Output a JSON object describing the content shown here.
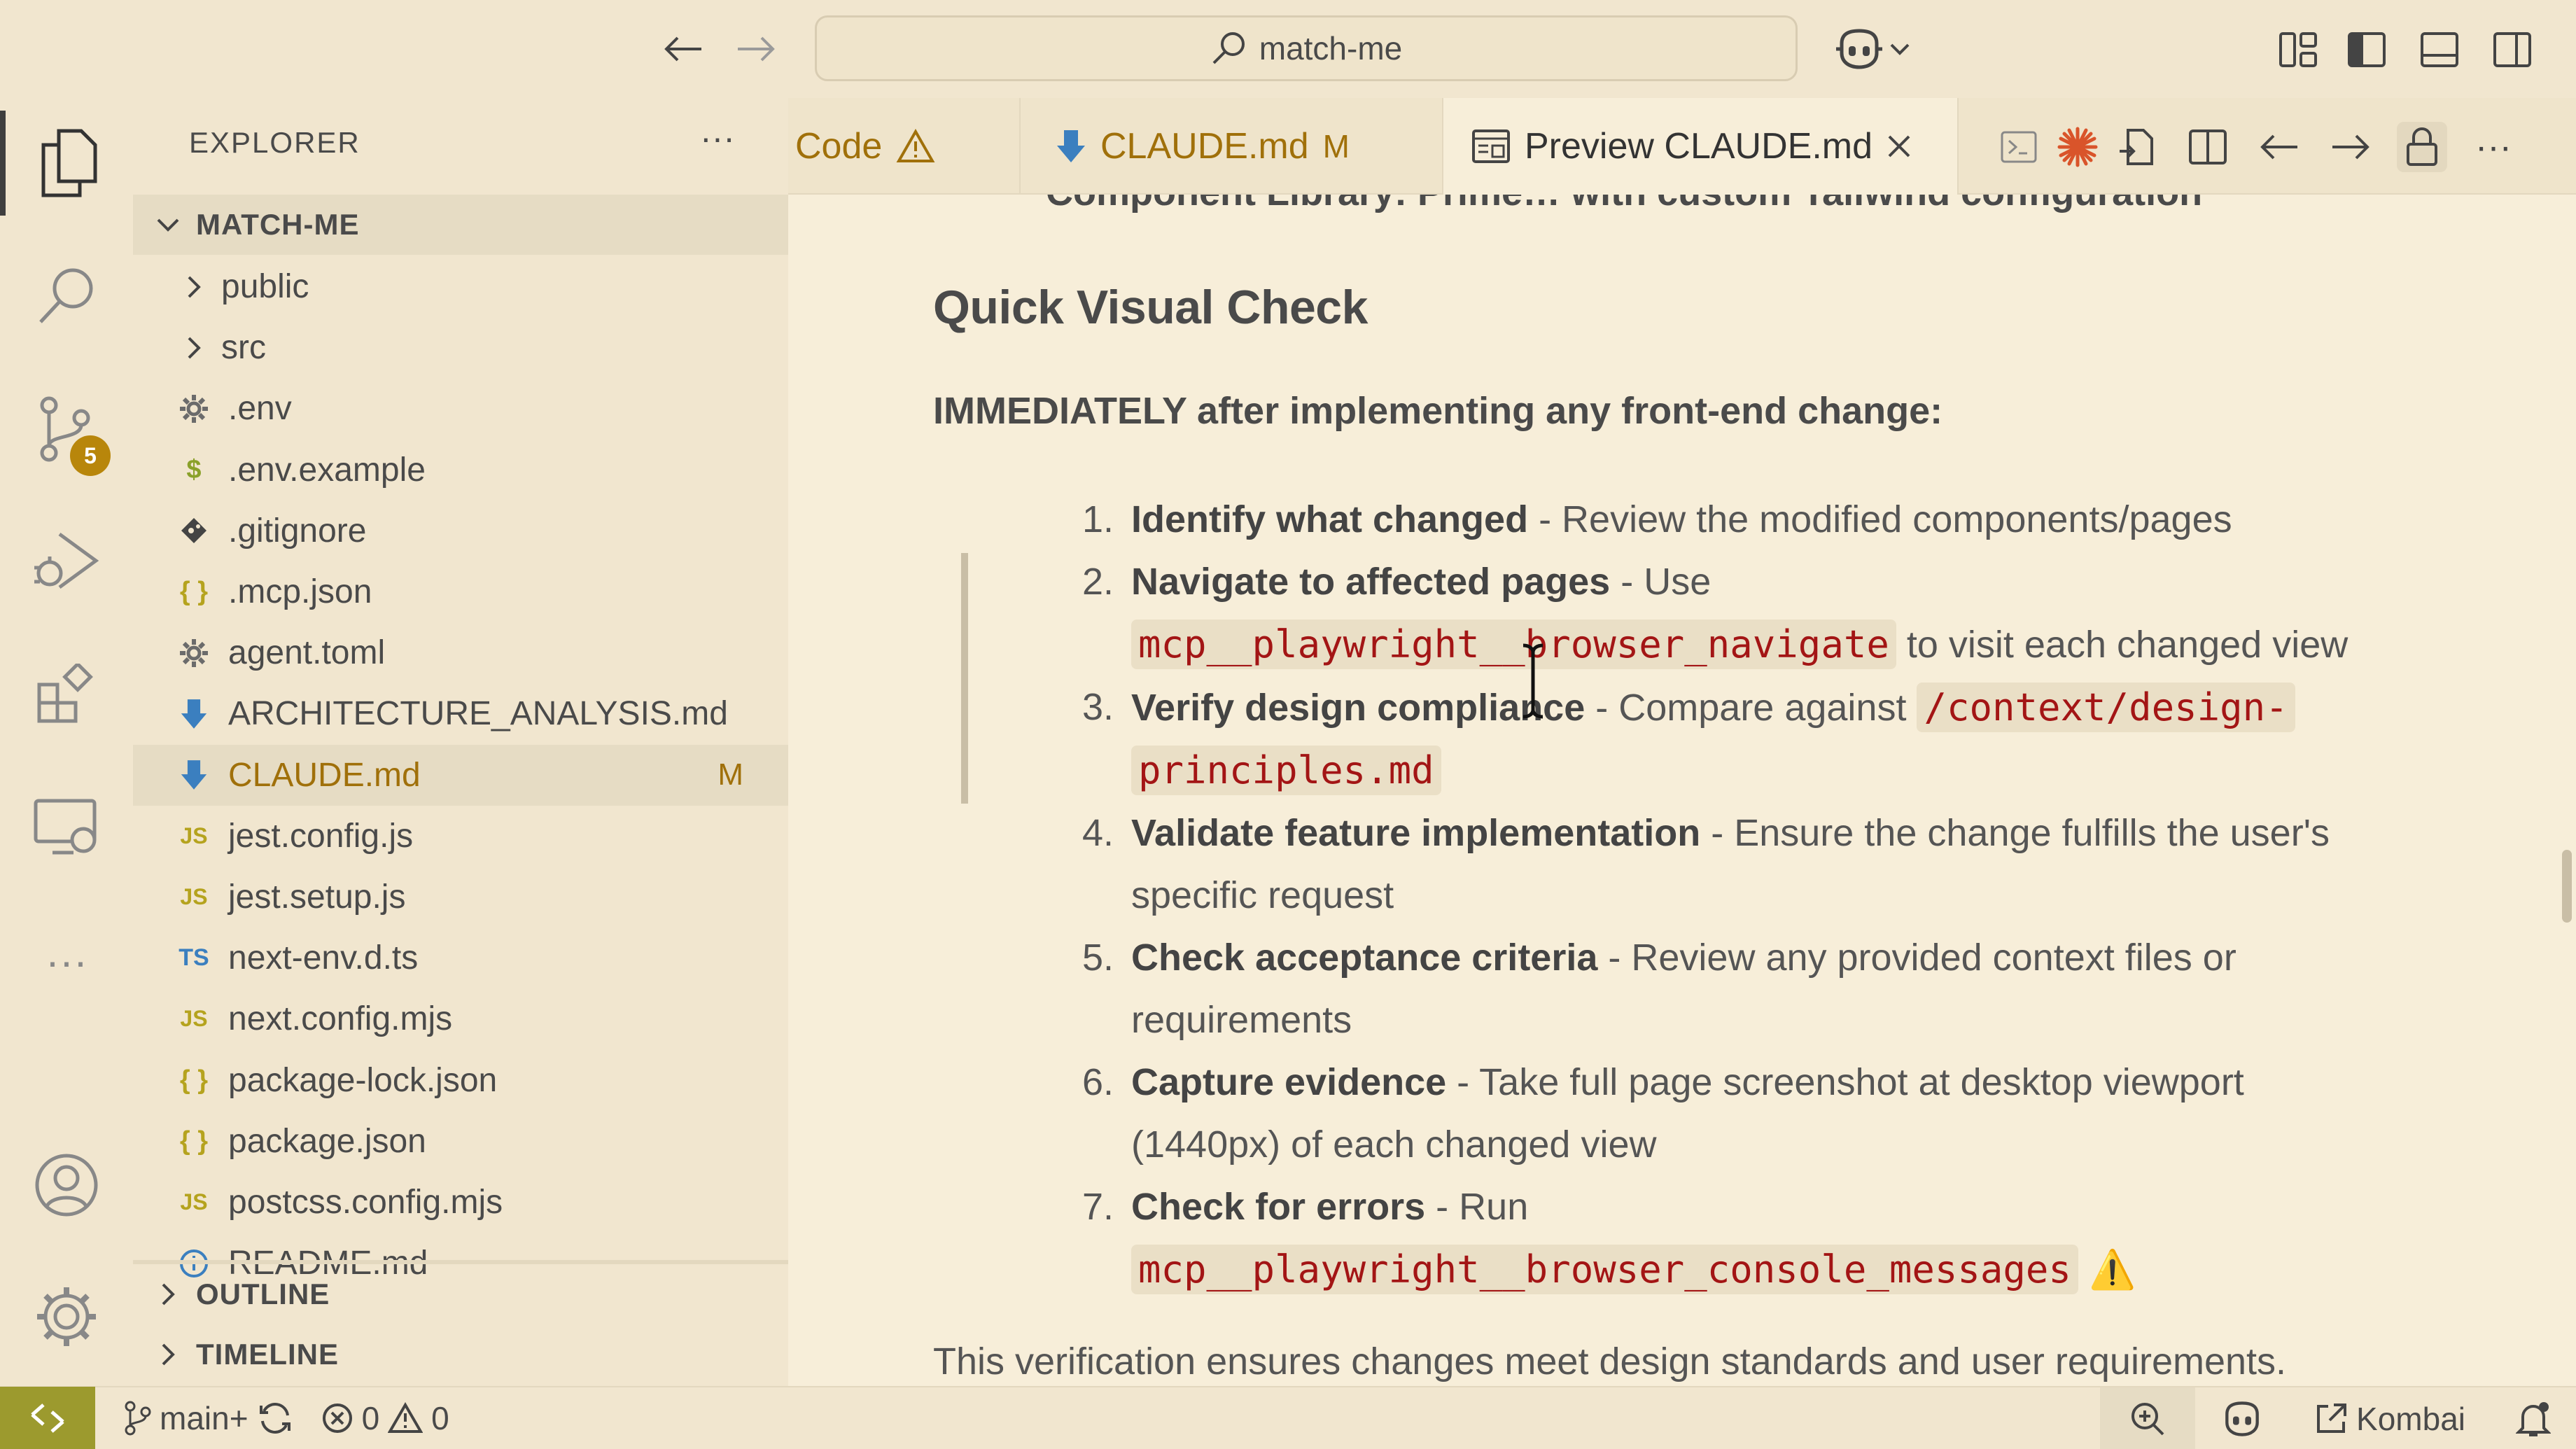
{
  "titlebar": {
    "search_text": "match-me"
  },
  "activity": {
    "source_control_badge": "5"
  },
  "sidebar": {
    "header": "EXPLORER",
    "more": "···",
    "project": "MATCH-ME",
    "files": [
      {
        "name": "public",
        "icon": "chevron-right"
      },
      {
        "name": "src",
        "icon": "chevron-right"
      },
      {
        "name": ".env",
        "icon": "gear"
      },
      {
        "name": ".env.example",
        "icon": "dollar"
      },
      {
        "name": ".gitignore",
        "icon": "git"
      },
      {
        "name": ".mcp.json",
        "icon": "braces"
      },
      {
        "name": "agent.toml",
        "icon": "gear"
      },
      {
        "name": "ARCHITECTURE_ANALYSIS.md",
        "icon": "markdown-arrow"
      },
      {
        "name": "CLAUDE.md",
        "icon": "markdown-arrow",
        "git": "M"
      },
      {
        "name": "jest.config.js",
        "icon": "JS"
      },
      {
        "name": "jest.setup.js",
        "icon": "JS"
      },
      {
        "name": "next-env.d.ts",
        "icon": "TS"
      },
      {
        "name": "next.config.mjs",
        "icon": "JS"
      },
      {
        "name": "package-lock.json",
        "icon": "braces"
      },
      {
        "name": "package.json",
        "icon": "braces"
      },
      {
        "name": "postcss.config.mjs",
        "icon": "JS"
      },
      {
        "name": "README.md",
        "icon": "info"
      }
    ],
    "outline": "OUTLINE",
    "timeline": "TIMELINE"
  },
  "tabs": [
    {
      "label": "Code",
      "icon": "warning"
    },
    {
      "label": "CLAUDE.md",
      "icon": "markdown-arrow",
      "flag": "M"
    },
    {
      "label": "Preview CLAUDE.md",
      "icon": "preview",
      "active": true
    }
  ],
  "content": {
    "cut_line": "Component Library: Prime… with custom Tailwind configuration",
    "heading": "Quick Visual Check",
    "lead": "IMMEDIATELY after implementing any front-end change:",
    "items": [
      {
        "num": "1.",
        "title": "Identify what changed",
        "text": " - Review the modified components/pages"
      },
      {
        "num": "2.",
        "title": "Navigate to affected pages",
        "text": " - Use",
        "code": "mcp__playwright__browser_navigate",
        "after": " to visit each changed view"
      },
      {
        "num": "3.",
        "title": "Verify design compliance",
        "text": " - Compare against ",
        "code": "/context/design-",
        "code2": "principles.md"
      },
      {
        "num": "4.",
        "title": "Validate feature implementation",
        "text": " - Ensure the change fulfills the user's",
        "text2": "specific request"
      },
      {
        "num": "5.",
        "title": "Check acceptance criteria",
        "text": " - Review any provided context files or",
        "text2": "requirements"
      },
      {
        "num": "6.",
        "title": "Capture evidence",
        "text": " - Take full page screenshot at desktop viewport",
        "text2": "(1440px) of each changed view"
      },
      {
        "num": "7.",
        "title": "Check for errors",
        "text": " - Run",
        "code": "mcp__playwright__browser_console_messages",
        "emoji": "⚠️"
      }
    ],
    "closing": "This verification ensures changes meet design standards and user requirements."
  },
  "status": {
    "branch": "main+",
    "errors": "0",
    "warnings": "0",
    "kombai": "Kombai"
  },
  "colors": {
    "background": "#f7eed9",
    "chrome": "#f1e6cf",
    "code_text": "#a31515",
    "modified": "#a0700a",
    "remote": "#9c9a2e"
  }
}
